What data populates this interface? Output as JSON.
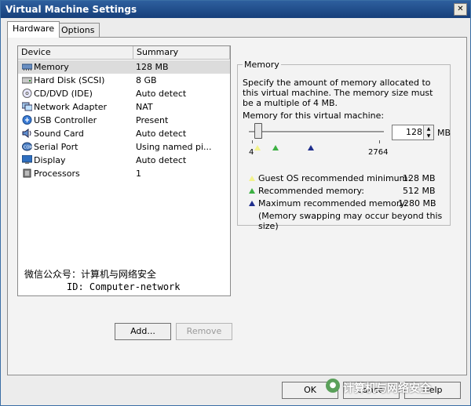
{
  "window": {
    "title": "Virtual Machine Settings",
    "close_glyph": "✕"
  },
  "tabs": [
    {
      "label": "Hardware",
      "active": true
    },
    {
      "label": "Options",
      "active": false
    }
  ],
  "device_list": {
    "columns": [
      "Device",
      "Summary"
    ],
    "rows": [
      {
        "device": "Memory",
        "summary": "128 MB",
        "icon": "memory-icon",
        "selected": true
      },
      {
        "device": "Hard Disk (SCSI)",
        "summary": "8 GB",
        "icon": "hard-disk-icon"
      },
      {
        "device": "CD/DVD (IDE)",
        "summary": "Auto detect",
        "icon": "cd-dvd-icon"
      },
      {
        "device": "Network Adapter",
        "summary": "NAT",
        "icon": "network-adapter-icon"
      },
      {
        "device": "USB Controller",
        "summary": "Present",
        "icon": "usb-icon"
      },
      {
        "device": "Sound Card",
        "summary": "Auto detect",
        "icon": "sound-card-icon"
      },
      {
        "device": "Serial Port",
        "summary": "Using named pi...",
        "icon": "serial-port-icon"
      },
      {
        "device": "Display",
        "summary": "Auto detect",
        "icon": "display-icon"
      },
      {
        "device": "Processors",
        "summary": "1",
        "icon": "processor-icon"
      }
    ]
  },
  "watermark": {
    "line1": "微信公众号：计算机与网络安全",
    "line2": "ID: Computer-network"
  },
  "buttons": {
    "add": "Add...",
    "remove": "Remove",
    "ok": "OK",
    "cancel": "Cancel",
    "help": "Help"
  },
  "memory": {
    "group_label": "Memory",
    "description": "Specify the amount of memory allocated to this virtual machine. The memory size must be a multiple of 4 MB.",
    "field_label": "Memory for this virtual machine:",
    "value": "128",
    "unit": "MB",
    "slider": {
      "min": 4,
      "max": 2764,
      "min_label": "4",
      "max_label": "2764",
      "current_mb": 128,
      "markers": {
        "guest_min_mb": 128,
        "recommended_mb": 512,
        "maximum_mb": 1280
      }
    },
    "legend": [
      {
        "label": "Guest OS recommended minimum:",
        "value": "128 MB",
        "color": "#f2f28a"
      },
      {
        "label": "Recommended memory:",
        "value": "512 MB",
        "color": "#3cb043"
      },
      {
        "label": "Maximum recommended memory:",
        "value": "1280 MB",
        "color": "#1f2e8c"
      }
    ],
    "note": "(Memory swapping may occur beyond this size)"
  },
  "bottom_watermark": "计算机与网络安全",
  "colors": {
    "title_bar": "#1f4f8f",
    "selection": "#dcdcdc"
  }
}
